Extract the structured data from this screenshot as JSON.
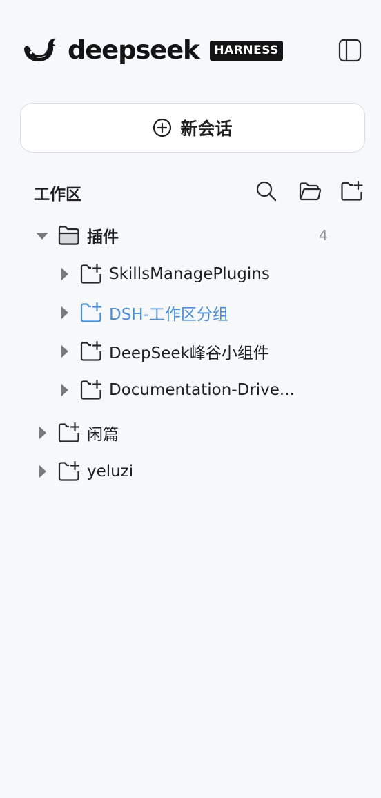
{
  "brand": {
    "name": "deepseek",
    "badge": "HARNESS",
    "logo_icon": "deepseek-whale-icon"
  },
  "header": {
    "toggle_icon": "sidebar-toggle-icon"
  },
  "new_chat": {
    "label": "新会话",
    "icon": "plus-circle-icon"
  },
  "workspace": {
    "title": "工作区",
    "actions": [
      {
        "name": "search",
        "icon": "search-icon"
      },
      {
        "name": "open-folder",
        "icon": "folder-open-icon"
      },
      {
        "name": "new-folder",
        "icon": "folder-plus-icon"
      }
    ],
    "tree": [
      {
        "label": "插件",
        "count": "4",
        "expanded": true,
        "children": [
          {
            "label": "SkillsManagePlugins"
          },
          {
            "label": "DSH-工作区分组",
            "highlighted": true
          },
          {
            "label": "DeepSeek峰谷小组件"
          },
          {
            "label": "Documentation-Drive..."
          }
        ]
      },
      {
        "label": "闲篇",
        "expanded": false
      },
      {
        "label": "yeluzi",
        "expanded": false
      }
    ]
  },
  "colors": {
    "background": "#f7f8fa",
    "text": "#1f1f1f",
    "accent": "#4a8fd6",
    "muted": "#8a8a8a",
    "icon": "#2a2a2a",
    "caret": "#7a7a7a"
  }
}
